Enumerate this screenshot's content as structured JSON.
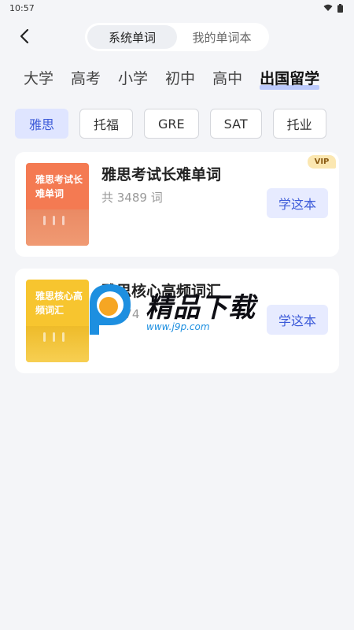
{
  "status": {
    "time": "10:57"
  },
  "header": {
    "tabs": [
      {
        "label": "系统单词",
        "active": true
      },
      {
        "label": "我的单词本",
        "active": false
      }
    ]
  },
  "categories": [
    {
      "label": "大学",
      "active": false
    },
    {
      "label": "高考",
      "active": false
    },
    {
      "label": "小学",
      "active": false
    },
    {
      "label": "初中",
      "active": false
    },
    {
      "label": "高中",
      "active": false
    },
    {
      "label": "出国留学",
      "active": true
    }
  ],
  "subcategories": [
    {
      "label": "雅思",
      "active": true
    },
    {
      "label": "托福",
      "active": false
    },
    {
      "label": "GRE",
      "active": false
    },
    {
      "label": "SAT",
      "active": false
    },
    {
      "label": "托业",
      "active": false
    }
  ],
  "books": [
    {
      "cover_text": "雅思考试长难单词",
      "title": "雅思考试长难单词",
      "count": "共 3489 词",
      "button": "学这本",
      "badge": "VIP",
      "cover_color": "#f47a52",
      "band_color": "#e0673f"
    },
    {
      "cover_text": "雅思核心高频词汇",
      "title": "雅思核心高频词汇",
      "count": "共 674",
      "button": "学这本",
      "badge": "",
      "cover_color": "#f7c52f",
      "band_color": "#e9b418"
    }
  ],
  "watermark": {
    "text": "精品下载",
    "url": "www.j9p.com"
  },
  "colors": {
    "accent": "#3d5bd9",
    "accent_bg": "#e7ebff",
    "background": "#f4f5f8"
  }
}
